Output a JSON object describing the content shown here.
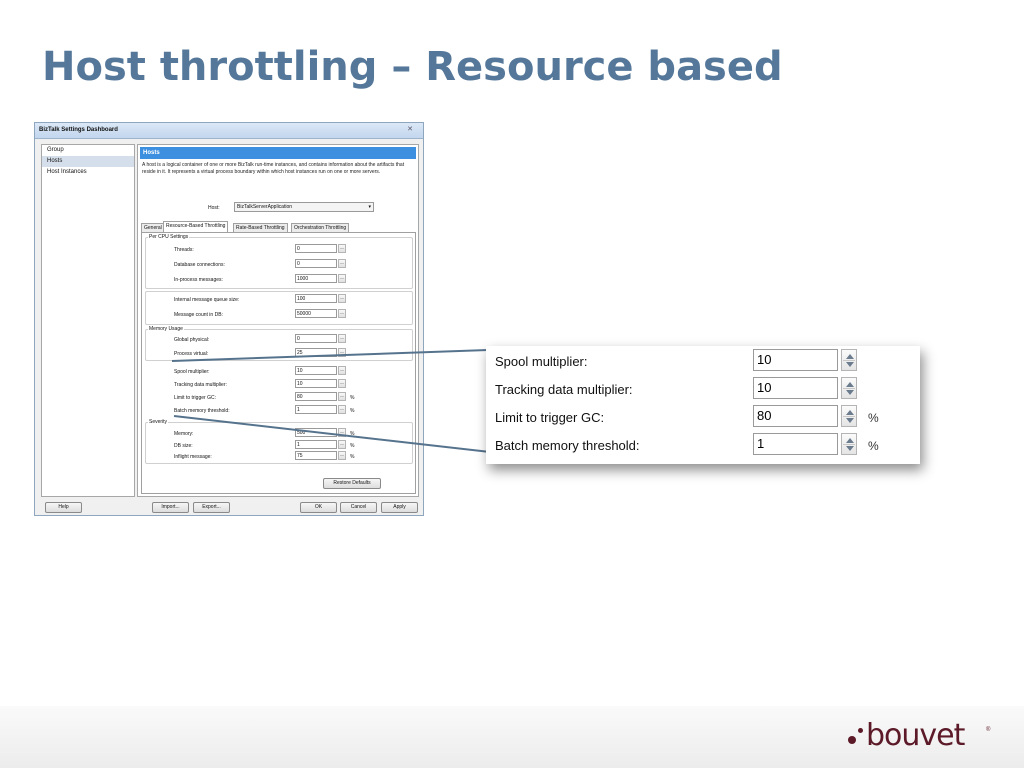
{
  "slide": {
    "title": "Host throttling – Resource based"
  },
  "dialog": {
    "title": "BizTalk Settings Dashboard",
    "close_icon": "✕",
    "nav": [
      "Group",
      "Hosts",
      "Host Instances"
    ],
    "selected_nav": "Hosts",
    "header": "Hosts",
    "description": "A host is a logical container of one or more BizTalk run-time instances, and contains information about the artifacts that reside in it. It represents a virtual process boundary within which host instances run on one or more servers.",
    "host_label": "Host:",
    "host_value": "BizTalkServerApplication",
    "tabs": [
      "General",
      "Resource-Based Throttling",
      "Rate-Based Throttling",
      "Orchestration Throttling"
    ],
    "active_tab": "Resource-Based Throttling",
    "groups": {
      "per_cpu": "Per CPU Settings",
      "memory": "Memory Usage",
      "severity": "Severity"
    },
    "fields": {
      "threads": {
        "label": "Threads:",
        "value": "0"
      },
      "db_connections": {
        "label": "Database connections:",
        "value": "0"
      },
      "in_process": {
        "label": "In-process messages:",
        "value": "1000"
      },
      "queue_size": {
        "label": "Internal message queue size:",
        "value": "100"
      },
      "msg_count_db": {
        "label": "Message count in DB:",
        "value": "50000"
      },
      "global_physical": {
        "label": "Global physical:",
        "value": "0"
      },
      "process_virtual": {
        "label": "Process virtual:",
        "value": "25"
      },
      "spool_multiplier": {
        "label": "Spool multiplier:",
        "value": "10"
      },
      "tracking_multiplier": {
        "label": "Tracking data multiplier:",
        "value": "10"
      },
      "limit_gc": {
        "label": "Limit to trigger GC:",
        "value": "80",
        "unit": "%"
      },
      "batch_memory": {
        "label": "Batch memory threshold:",
        "value": "1",
        "unit": "%"
      },
      "memory": {
        "label": "Memory:",
        "value": "500",
        "unit": "%"
      },
      "db_size": {
        "label": "DB size:",
        "value": "1",
        "unit": "%"
      },
      "inflight": {
        "label": "Inflight message:",
        "value": "75",
        "unit": "%"
      }
    },
    "buttons": {
      "restore_defaults": "Restore Defaults",
      "help": "Help",
      "import": "Import...",
      "export": "Export...",
      "ok": "OK",
      "cancel": "Cancel",
      "apply": "Apply"
    }
  },
  "callout": {
    "rows": [
      {
        "label": "Spool multiplier:",
        "value": "10",
        "unit": ""
      },
      {
        "label": "Tracking data multiplier:",
        "value": "10",
        "unit": ""
      },
      {
        "label": "Limit to trigger GC:",
        "value": "80",
        "unit": "%"
      },
      {
        "label": "Batch memory threshold:",
        "value": "1",
        "unit": "%"
      }
    ]
  },
  "logo": {
    "name": "bouvet",
    "registered": "®"
  },
  "colors": {
    "title": "#55789a",
    "header_blue": "#3d8fe0",
    "connector": "#56738d",
    "logo": "#5c1a28"
  }
}
